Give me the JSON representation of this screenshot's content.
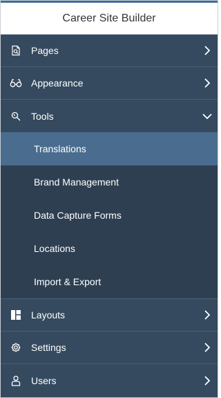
{
  "header": {
    "title": "Career Site Builder"
  },
  "nav": {
    "pages": {
      "label": "Pages",
      "icon": "page-search-icon",
      "expanded": false
    },
    "appearance": {
      "label": "Appearance",
      "icon": "glasses-icon",
      "expanded": false
    },
    "tools": {
      "label": "Tools",
      "icon": "wrench-search-icon",
      "expanded": true,
      "items": [
        {
          "label": "Translations",
          "selected": true
        },
        {
          "label": "Brand Management",
          "selected": false
        },
        {
          "label": "Data Capture Forms",
          "selected": false
        },
        {
          "label": "Locations",
          "selected": false
        },
        {
          "label": "Import & Export",
          "selected": false
        }
      ]
    },
    "layouts": {
      "label": "Layouts",
      "icon": "layout-icon",
      "expanded": false
    },
    "settings": {
      "label": "Settings",
      "icon": "gear-icon",
      "expanded": false
    },
    "users": {
      "label": "Users",
      "icon": "user-icon",
      "expanded": false
    }
  },
  "colors": {
    "nav_background": "#354a5f",
    "subnav_background": "#2e3f51",
    "selected_background": "#4a6d8f",
    "header_background": "#ffffff"
  }
}
